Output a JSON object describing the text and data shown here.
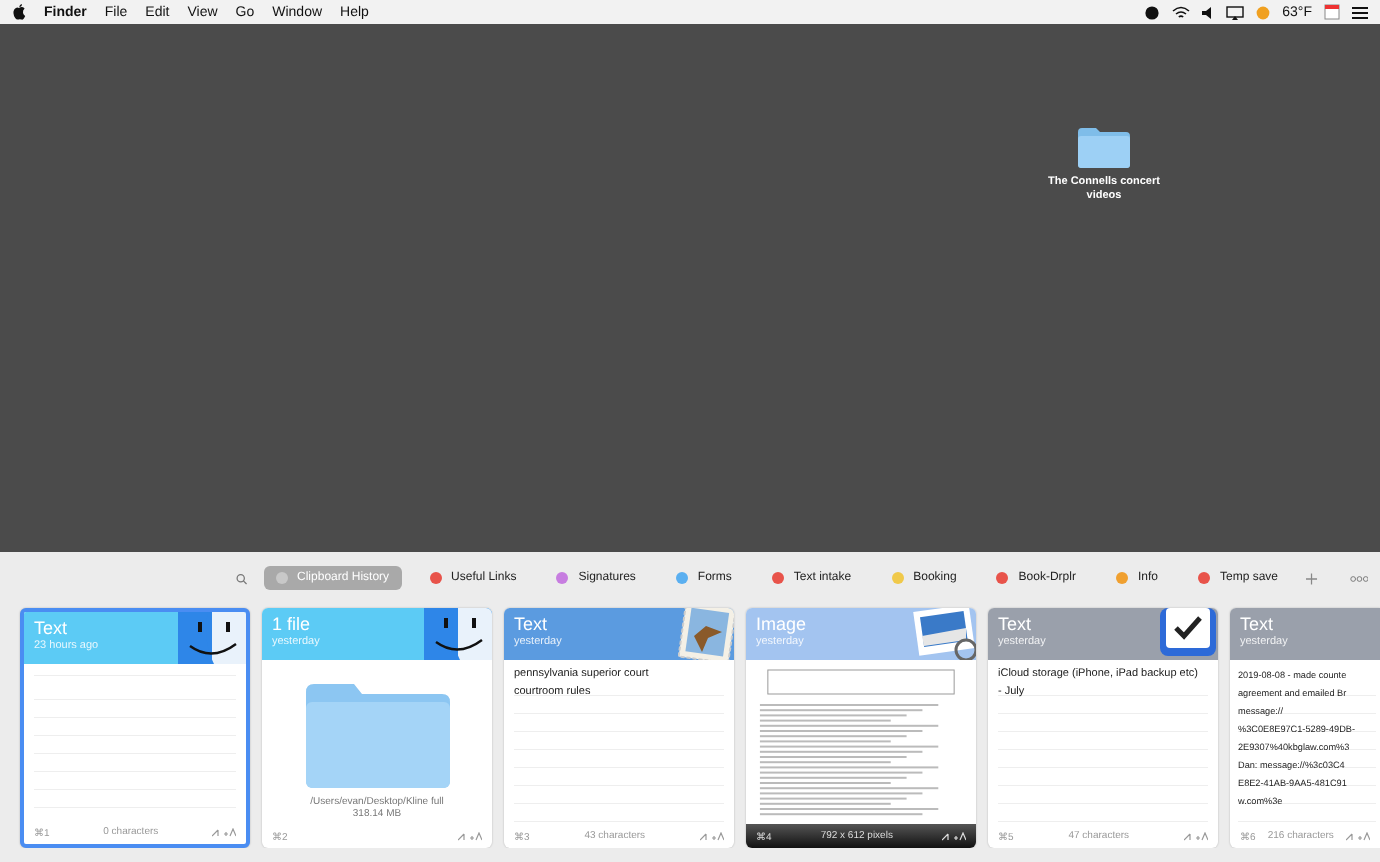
{
  "menu_bar": {
    "app_name": "Finder",
    "items": [
      "File",
      "Edit",
      "View",
      "Go",
      "Window",
      "Help"
    ],
    "temperature": "63°F"
  },
  "desktop": {
    "icons": [
      {
        "label": "The Connells concert videos"
      }
    ]
  },
  "pinboards": {
    "tabs": [
      {
        "label": "Clipboard History",
        "color": "#c8c8c8",
        "selected": true
      },
      {
        "label": "Useful Links",
        "color": "#e8534a",
        "selected": false
      },
      {
        "label": "Signatures",
        "color": "#c77de0",
        "selected": false
      },
      {
        "label": "Forms",
        "color": "#5aaff0",
        "selected": false
      },
      {
        "label": "Text intake",
        "color": "#e8534a",
        "selected": false
      },
      {
        "label": "Booking",
        "color": "#f0c94a",
        "selected": false
      },
      {
        "label": "Book-Drplr",
        "color": "#e8534a",
        "selected": false
      },
      {
        "label": "Info",
        "color": "#f0a030",
        "selected": false
      },
      {
        "label": "Temp save",
        "color": "#e8534a",
        "selected": false
      }
    ]
  },
  "clips": [
    {
      "kind": "finder_text",
      "title": "Text",
      "time": "23 hours ago",
      "color": "#5ccbf5",
      "selected": true,
      "index": "⌘1",
      "info": [
        "0 characters"
      ]
    },
    {
      "kind": "finder_file",
      "title": "1 file",
      "time": "yesterday",
      "color": "#5ccbf5",
      "selected": false,
      "index": "⌘2",
      "info": [
        "/Users/evan/Desktop/Kline full",
        "318.14 MB"
      ]
    },
    {
      "kind": "mail_text",
      "title": "Text",
      "time": "yesterday",
      "color": "#5b9be0",
      "selected": false,
      "lines": [
        "pennsylvania superior court",
        "courtroom rules"
      ],
      "index": "⌘3",
      "info": [
        "43 characters"
      ]
    },
    {
      "kind": "preview_image",
      "title": "Image",
      "time": "yesterday",
      "color": "#a3c4f0",
      "selected": false,
      "index": "⌘4",
      "info": [
        "792 x 612 pixels"
      ]
    },
    {
      "kind": "tasks_text",
      "title": "Text",
      "time": "yesterday",
      "color": "#9aa0ab",
      "selected": false,
      "lines": [
        "iCloud storage (iPhone, iPad backup etc)",
        "- July"
      ],
      "index": "⌘5",
      "info": [
        "47 characters"
      ]
    },
    {
      "kind": "plain_text",
      "title": "Text",
      "time": "yesterday",
      "color": "#9aa0ab",
      "selected": false,
      "lines": [
        "2019-08-08 - made counte",
        "agreement and emailed Br",
        "message://",
        "%3C0E8E97C1-5289-49DB-",
        "2E9307%40kbglaw.com%3",
        "Dan: message://%3c03C4",
        "E8E2-41AB-9AA5-481C91",
        "w.com%3e"
      ],
      "index": "⌘6",
      "info": [
        "216 characters"
      ]
    }
  ]
}
